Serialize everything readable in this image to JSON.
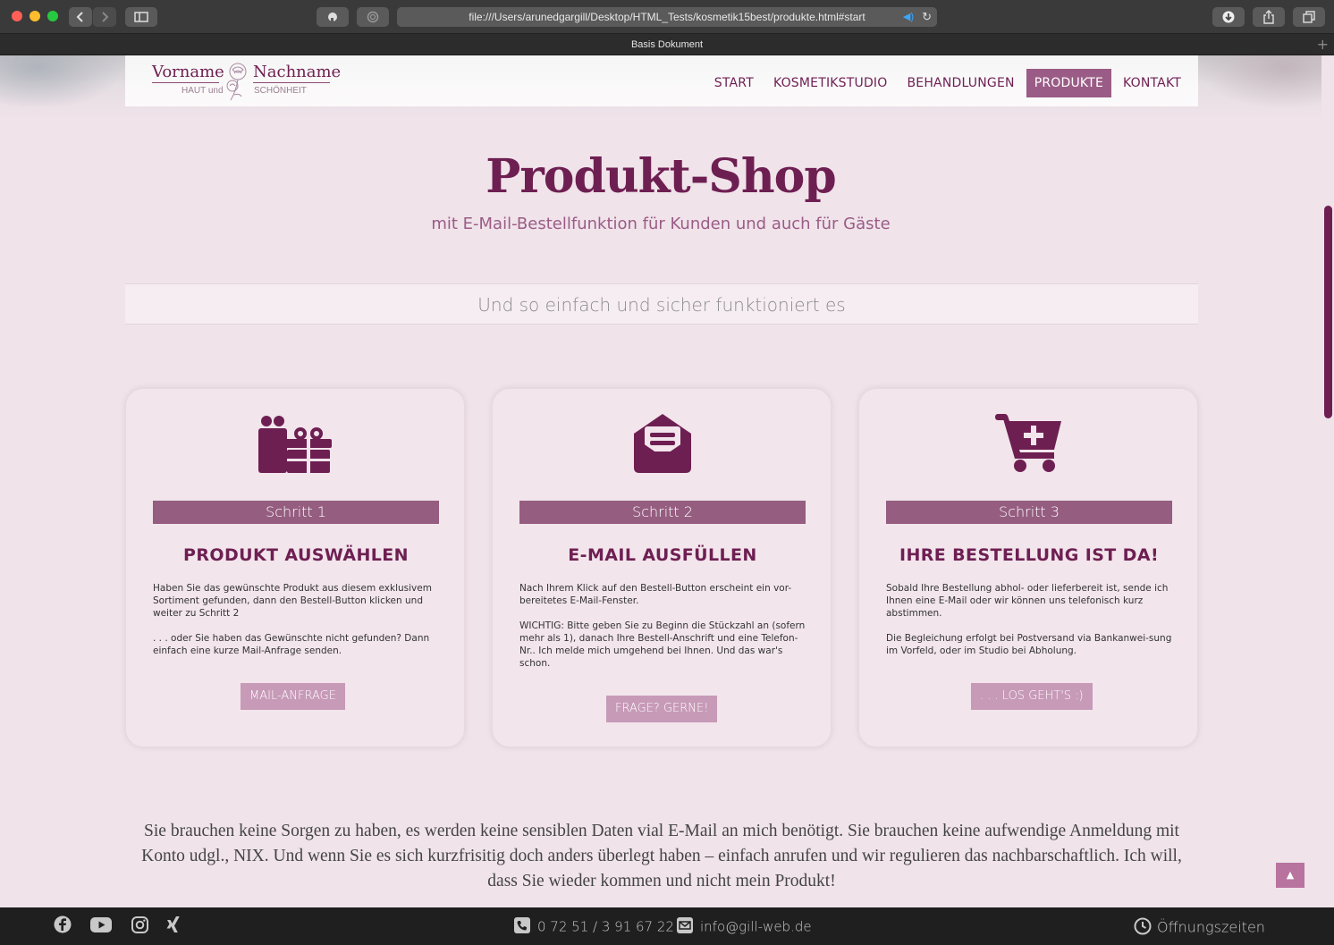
{
  "browser": {
    "url": "file:///Users/arunedgargill/Desktop/HTML_Tests/kosmetik15best/produkte.html#start",
    "tab_title": "Basis Dokument",
    "reload_icon": "↻",
    "new_tab_icon": "+"
  },
  "header": {
    "logo_first": "Vorname",
    "logo_last": "Nachname",
    "logo_sub_left": "HAUT und",
    "logo_sub_right": "SCHÖNHEIT",
    "nav": [
      {
        "label": "START",
        "active": false
      },
      {
        "label": "KOSMETIKSTUDIO",
        "active": false
      },
      {
        "label": "BEHANDLUNGEN",
        "active": false
      },
      {
        "label": "PRODUKTE",
        "active": true
      },
      {
        "label": "KONTAKT",
        "active": false
      }
    ]
  },
  "hero": {
    "title": "Produkt-Shop",
    "subtitle": "mit E-Mail-Bestellfunktion für Kunden und auch für Gäste"
  },
  "banner": "Und so einfach und sicher funktioniert es",
  "steps": [
    {
      "icon": "gift-icon",
      "step": "Schritt 1",
      "title": "PRODUKT AUSWÄHLEN",
      "text1": "Haben Sie das gewünschte Produkt aus diesem exklusivem Sortiment gefunden, dann den Bestell-Button klicken und weiter zu Schritt 2",
      "text2": ". . . oder Sie haben das Gewünschte nicht gefunden? Dann einfach eine kurze Mail-Anfrage senden.",
      "button": "MAIL-ANFRAGE"
    },
    {
      "icon": "envelope-open-icon",
      "step": "Schritt 2",
      "title": "E-MAIL AUSFÜLLEN",
      "text1": "Nach Ihrem Klick auf den Bestell-Button erscheint ein vor-bereitetes E-Mail-Fenster.",
      "text2": "WICHTIG: Bitte geben Sie zu Beginn die Stückzahl an (sofern mehr als 1), danach Ihre Bestell-Anschrift und eine Telefon-Nr.. Ich melde mich umgehend bei Ihnen. Und das war's schon.",
      "button": "FRAGE? GERNE!"
    },
    {
      "icon": "cart-plus-icon",
      "step": "Schritt 3",
      "title": "IHRE BESTELLUNG IST DA!",
      "text1": "Sobald Ihre Bestellung abhol- oder lieferbereit ist, sende ich Ihnen eine E-Mail oder wir können uns telefonisch kurz abstimmen.",
      "text2": "Die Begleichung erfolgt bei Postversand via Bankanwei-sung im Vorfeld, oder im Studio bei Abholung.",
      "button": ". . . LOS GEHT'S :)"
    }
  ],
  "bottom_text": "Sie brauchen keine Sorgen zu haben, es werden keine sensiblen Daten vial E-Mail an mich benötigt. Sie brauchen keine aufwendige Anmeldung mit Konto udgl., NIX. Und wenn Sie es sich kurzfrisitig doch anders überlegt haben – einfach anrufen und wir regulieren das nachbarschaftlich. Ich will, dass Sie wieder kommen und nicht mein Produkt!",
  "totop": "▲",
  "footer": {
    "phone": "0 72 51 / 3 91 67 22",
    "email": "info@gill-web.de",
    "hours": "Öffnungszeiten"
  },
  "colors": {
    "accent": "#6e1f52",
    "step_bar": "#955d80",
    "button": "#c79ab8",
    "page_bg": "#f0e3ea"
  }
}
